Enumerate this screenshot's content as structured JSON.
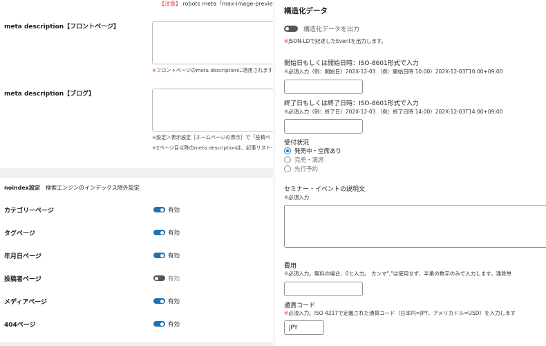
{
  "left": {
    "top_note": {
      "prefix": "【注意】",
      "text": "robots meta「max-image-preview」の出力"
    },
    "front_desc": {
      "label": "meta description【フロントページ】",
      "note_ast": "※",
      "note": "フロントページのmeta descriptionに適用されます"
    },
    "blog_desc": {
      "label": "meta description【ブログ】",
      "note1_ast": "※",
      "note1": "設定＞表示設定［ホームページの表示］で「投稿ペ",
      "note2_ast": "※",
      "note2": "2ページ目以降のmeta descriptionは、記事リスト-"
    },
    "noindex": {
      "title": "noindex設定",
      "subtitle": "検索エンジンのインデックス除外設定",
      "rows": [
        {
          "label": "カテゴリーページ",
          "value": "有効",
          "on": true
        },
        {
          "label": "タグページ",
          "value": "有効",
          "on": true
        },
        {
          "label": "年月日ページ",
          "value": "有効",
          "on": true
        },
        {
          "label": "投稿者ページ",
          "value": "有効",
          "on": false
        },
        {
          "label": "メディアページ",
          "value": "有効",
          "on": true
        },
        {
          "label": "404ページ",
          "value": "有効",
          "on": true
        }
      ]
    }
  },
  "right": {
    "title": "構造化データ",
    "toggle_label": "構造化データを出力",
    "toggle_note_ast": "※",
    "toggle_note": "JSON-LDで記述したEventを出力します。",
    "start": {
      "label": "開始日もしくは開始日時：ISO-8601形式で入力",
      "note_ast": "※",
      "note": "必須入力（例：開始日）202X-12-03 （例：開始日時 10:00）202X-12-03T10:00+09:00",
      "value": ""
    },
    "end": {
      "label": "終了日もしくは終了日時：ISO-8601形式で入力",
      "note_ast": "※",
      "note": "必須入力（例：終了日）202X-12-03 （例：終了日時 14:00）202X-12-03T14:00+09:00",
      "value": ""
    },
    "status": {
      "label": "受付状況",
      "options": [
        {
          "label": "発売中・空席あり",
          "selected": true
        },
        {
          "label": "完売・満席",
          "selected": false
        },
        {
          "label": "先行予約",
          "selected": false
        }
      ]
    },
    "description": {
      "label": "セミナー・イベントの説明文",
      "note_ast": "※",
      "note": "必須入力"
    },
    "fee": {
      "label": "費用",
      "note_ast": "※",
      "note": "必須入力。無料の場合、0と入力。 カンマ\",\"は使用せず、半角の数字のみで入力します。通貨単",
      "value": ""
    },
    "currency": {
      "label": "通貨コード",
      "note_ast": "※",
      "note": "必須入力。ISO 4217で定義された通貨コード（日本円=JPY、アメリカドル=USD）を入力します",
      "value": "JPY"
    }
  }
}
